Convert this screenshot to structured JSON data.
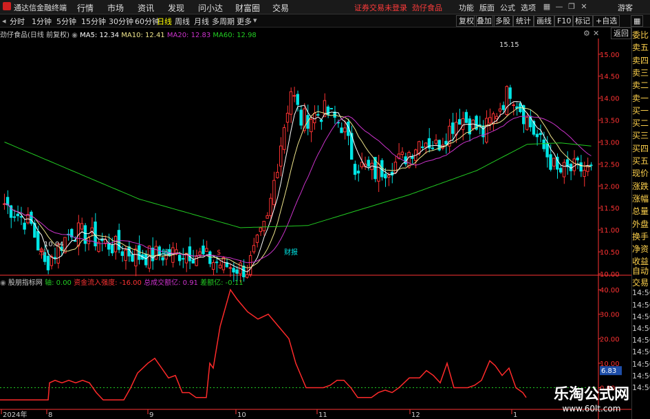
{
  "app": {
    "title": "通达信金融终端",
    "status": "证券交易未登录",
    "stock": "劲仔食品"
  },
  "menu": [
    "行情",
    "市场",
    "资讯",
    "发现",
    "问小达",
    "财富圈",
    "交易"
  ],
  "sysmenu": [
    "功能",
    "版面",
    "公式",
    "选项"
  ],
  "guest": "游客",
  "periods": [
    "分时",
    "1分钟",
    "5分钟",
    "15分钟",
    "30分钟",
    "60分钟",
    "日线",
    "周线",
    "月线",
    "多周期",
    "更多"
  ],
  "active_period": "日线",
  "tools": [
    "复权",
    "叠加",
    "多股",
    "统计",
    "画线",
    "F10",
    "标记",
    "+自选"
  ],
  "back_btn": "返回",
  "quote": {
    "name": "劲仔食品(日线 前复权)",
    "ma5": "MA5: 12.34",
    "ma10": "MA10: 12.41",
    "ma20": "MA20: 12.83",
    "ma60": "MA60: 12.98"
  },
  "colors": {
    "up": "#ff3333",
    "down": "#00e5e5",
    "ma5": "#ffffff",
    "ma10": "#f0e68c",
    "ma20": "#cc33cc",
    "ma60": "#22cc22",
    "axis": "#ff3333"
  },
  "price_axis": [
    "15.00",
    "14.50",
    "14.00",
    "13.50",
    "13.00",
    "12.50",
    "12.00",
    "11.50",
    "11.00",
    "10.50",
    "10.00"
  ],
  "annotations": {
    "high": "15.15",
    "low": "10.04",
    "events": [
      "涨",
      "解",
      "$",
      "财报"
    ]
  },
  "right_panel": [
    "委比",
    "卖五",
    "卖四",
    "卖三",
    "卖二",
    "卖一",
    "买一",
    "买二",
    "买三",
    "买四",
    "买五",
    "现价",
    "涨跌",
    "涨幅",
    "总量",
    "外盘",
    "换手",
    "净资",
    "收益"
  ],
  "right_panel2": [
    "自动",
    "交易",
    "14:56",
    "14:56",
    "14:56",
    "14:56",
    "14:56",
    "14:56",
    "14:56",
    "14:56",
    "14:56"
  ],
  "indicator": {
    "name": "股朋指标网",
    "axis": "轴: 0.00",
    "inflow": "资金流入强度: -16.00",
    "total": "总成交额亿: 0.91",
    "diff": "差额亿: -0.11",
    "ticks": [
      "40.00",
      "30.00",
      "20.00",
      "10.00",
      "0.00"
    ],
    "marker": "6.83"
  },
  "dates": [
    "2024年",
    "8",
    "9",
    "10",
    "11",
    "12",
    "1"
  ],
  "watermark": {
    "name": "乐淘公式网",
    "url": "www.60lt.com"
  },
  "chart_data": {
    "type": "line",
    "title": "劲仔食品(日线 前复权)",
    "x": [],
    "ylim": [
      10.0,
      15.15
    ],
    "series": [
      {
        "name": "MA60",
        "values": []
      }
    ],
    "indicator_ylim": [
      -8,
      42
    ]
  }
}
